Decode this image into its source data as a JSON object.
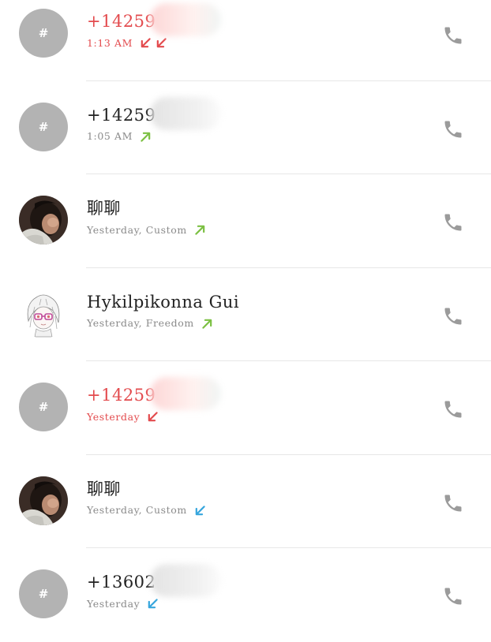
{
  "colors": {
    "missed": "#e34b4e",
    "outgoing": "#7cc043",
    "incoming": "#37a6dd",
    "secondary_text": "#8a8a8a",
    "call_icon": "#9b9b9b",
    "placeholder_avatar": "#b3b3b3"
  },
  "calls": [
    {
      "avatar": "placeholder",
      "avatar_glyph": "#",
      "name": "+14259",
      "status": "missed",
      "detail": "1:13 AM",
      "arrows": [
        "missed",
        "missed"
      ],
      "redacted": "pinkish",
      "call_icon": "phone-icon"
    },
    {
      "avatar": "placeholder",
      "avatar_glyph": "#",
      "name": "+14259",
      "status": "outgoing",
      "detail": "1:05 AM",
      "arrows": [
        "outgoing"
      ],
      "redacted": "greyish",
      "call_icon": "phone-icon"
    },
    {
      "avatar": "photo",
      "name": "聊聊",
      "status": "outgoing",
      "detail": "Yesterday, Custom",
      "arrows": [
        "outgoing"
      ],
      "call_icon": "phone-icon"
    },
    {
      "avatar": "anime",
      "name": "Hykilpikonna Gui",
      "status": "outgoing",
      "detail": "Yesterday, Freedom",
      "arrows": [
        "outgoing"
      ],
      "call_icon": "phone-icon"
    },
    {
      "avatar": "placeholder",
      "avatar_glyph": "#",
      "name": "+14259",
      "status": "missed",
      "detail": "Yesterday",
      "arrows": [
        "missed"
      ],
      "redacted": "pinkish",
      "call_icon": "phone-icon"
    },
    {
      "avatar": "photo",
      "name": "聊聊",
      "status": "incoming",
      "detail": "Yesterday, Custom",
      "arrows": [
        "incoming"
      ],
      "call_icon": "phone-icon"
    },
    {
      "avatar": "placeholder",
      "avatar_glyph": "#",
      "name": "+13602",
      "status": "incoming",
      "detail": "Yesterday",
      "arrows": [
        "incoming"
      ],
      "redacted": "greyish",
      "call_icon": "phone-icon"
    }
  ]
}
